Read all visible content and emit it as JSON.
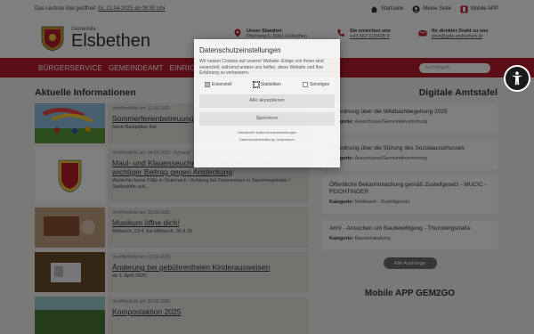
{
  "topbar": {
    "notice_prefix": "Das nächste Mal geöffnet:",
    "notice_date": "Di, 22.04.2025 ab 08:00 Uhr",
    "links": [
      {
        "label": "Startseite",
        "icon": "home-icon"
      },
      {
        "label": "Meine Seite",
        "icon": "user-icon"
      },
      {
        "label": "Mobile APP",
        "icon": "mobile-app-icon"
      }
    ]
  },
  "header": {
    "brand_small": "Gemeinde",
    "brand_big": "Elsbethen",
    "location_title": "Unser Standort",
    "location_text": "Pfarrweg 6, 5061 Elsbethen",
    "phone_title": "Sie erreichen uns",
    "phone_text": "+43 662 623428 0",
    "mail_title": "Ihr direkter Draht zu uns",
    "mail_text": "post@gde-elsbethen.at"
  },
  "nav": {
    "items": [
      "BÜRGERSERVICE",
      "GEMEINDEAMT",
      "EINRICHTUNGEN"
    ],
    "search_placeholder": "Suchbegriff"
  },
  "news": {
    "section_title": "Aktuelle Informationen",
    "items": [
      {
        "date": "Veröffentlicht am: 31.01.2025",
        "title": "Sommerferienbetreuung 2025",
        "text": "Noch Restplätze frei"
      },
      {
        "date": "Veröffentlicht am: 04.04.2025 · Schandr",
        "title": "Maul- und Klauenseuche: Vorsichtsmaßnahmen wichtiger Beitrag gegen Ansteckung",
        "text": "Weiterhin keine Fälle in Österreich / Achtung bei Ferienreisen in Seuchengebiete / Stallzutritte auf..."
      },
      {
        "date": "Veröffentlicht am: 03.04.2025",
        "title": "Musikum öffne dich!",
        "text": "Mittwoch, 23.4. bis Mittwoch, 30.4.25"
      },
      {
        "date": "Veröffentlicht am: 01.04.2025",
        "title": "Änderung bei gebührenfreien Kinderausweisen",
        "text": "ab 1. April 2025"
      },
      {
        "date": "Veröffentlicht am: 20.03.2025",
        "title": "Kompostaktion 2025",
        "text": ""
      }
    ]
  },
  "amtstafel": {
    "title": "Digitale Amtstafel",
    "category_label": "Kategorie:",
    "items": [
      {
        "title": "Verordnung über die Wildbachbegehung 2025",
        "category": "Ausschüsse/Gemeindevertretung"
      },
      {
        "title": "Verordnung über die Sitzung des Sozialausschusses",
        "category": "Ausschüsse/Gemeindevertretung"
      },
      {
        "title": "Öffentliche Bekanntmachung gemäß Zustellgesetz - MUCIC - FEICHTINGER",
        "category": "Meldeamt - Zustellgesetz"
      },
      {
        "title": "AmV - Ansuchen um Baubewilligung - Thurnbergstraße",
        "category": "Bauverhandlung"
      }
    ],
    "all_button": "Alle Aushänge",
    "mobile_title": "Mobile APP GEM2GO"
  },
  "cookie": {
    "title": "Datenschutzeinstellungen",
    "text": "Wir nutzen Cookies auf unserer Website. Einige von ihnen sind essenziell, während andere uns helfen, diese Website und Ihre Erfahrung zu verbessern.",
    "options": [
      {
        "label": "Essenziell",
        "checked": true
      },
      {
        "label": "Statistiken",
        "checked": false
      },
      {
        "label": "Sonstiges",
        "checked": false
      }
    ],
    "accept_all": "Alle akzeptieren",
    "save": "Speichern",
    "individual": "Individuelle Datenschutzeinstellungen",
    "footer_links": "Datenschutzerklärung | Impressum"
  },
  "colors": {
    "brand_red": "#b81c2e",
    "background": "#f4f2ee"
  }
}
